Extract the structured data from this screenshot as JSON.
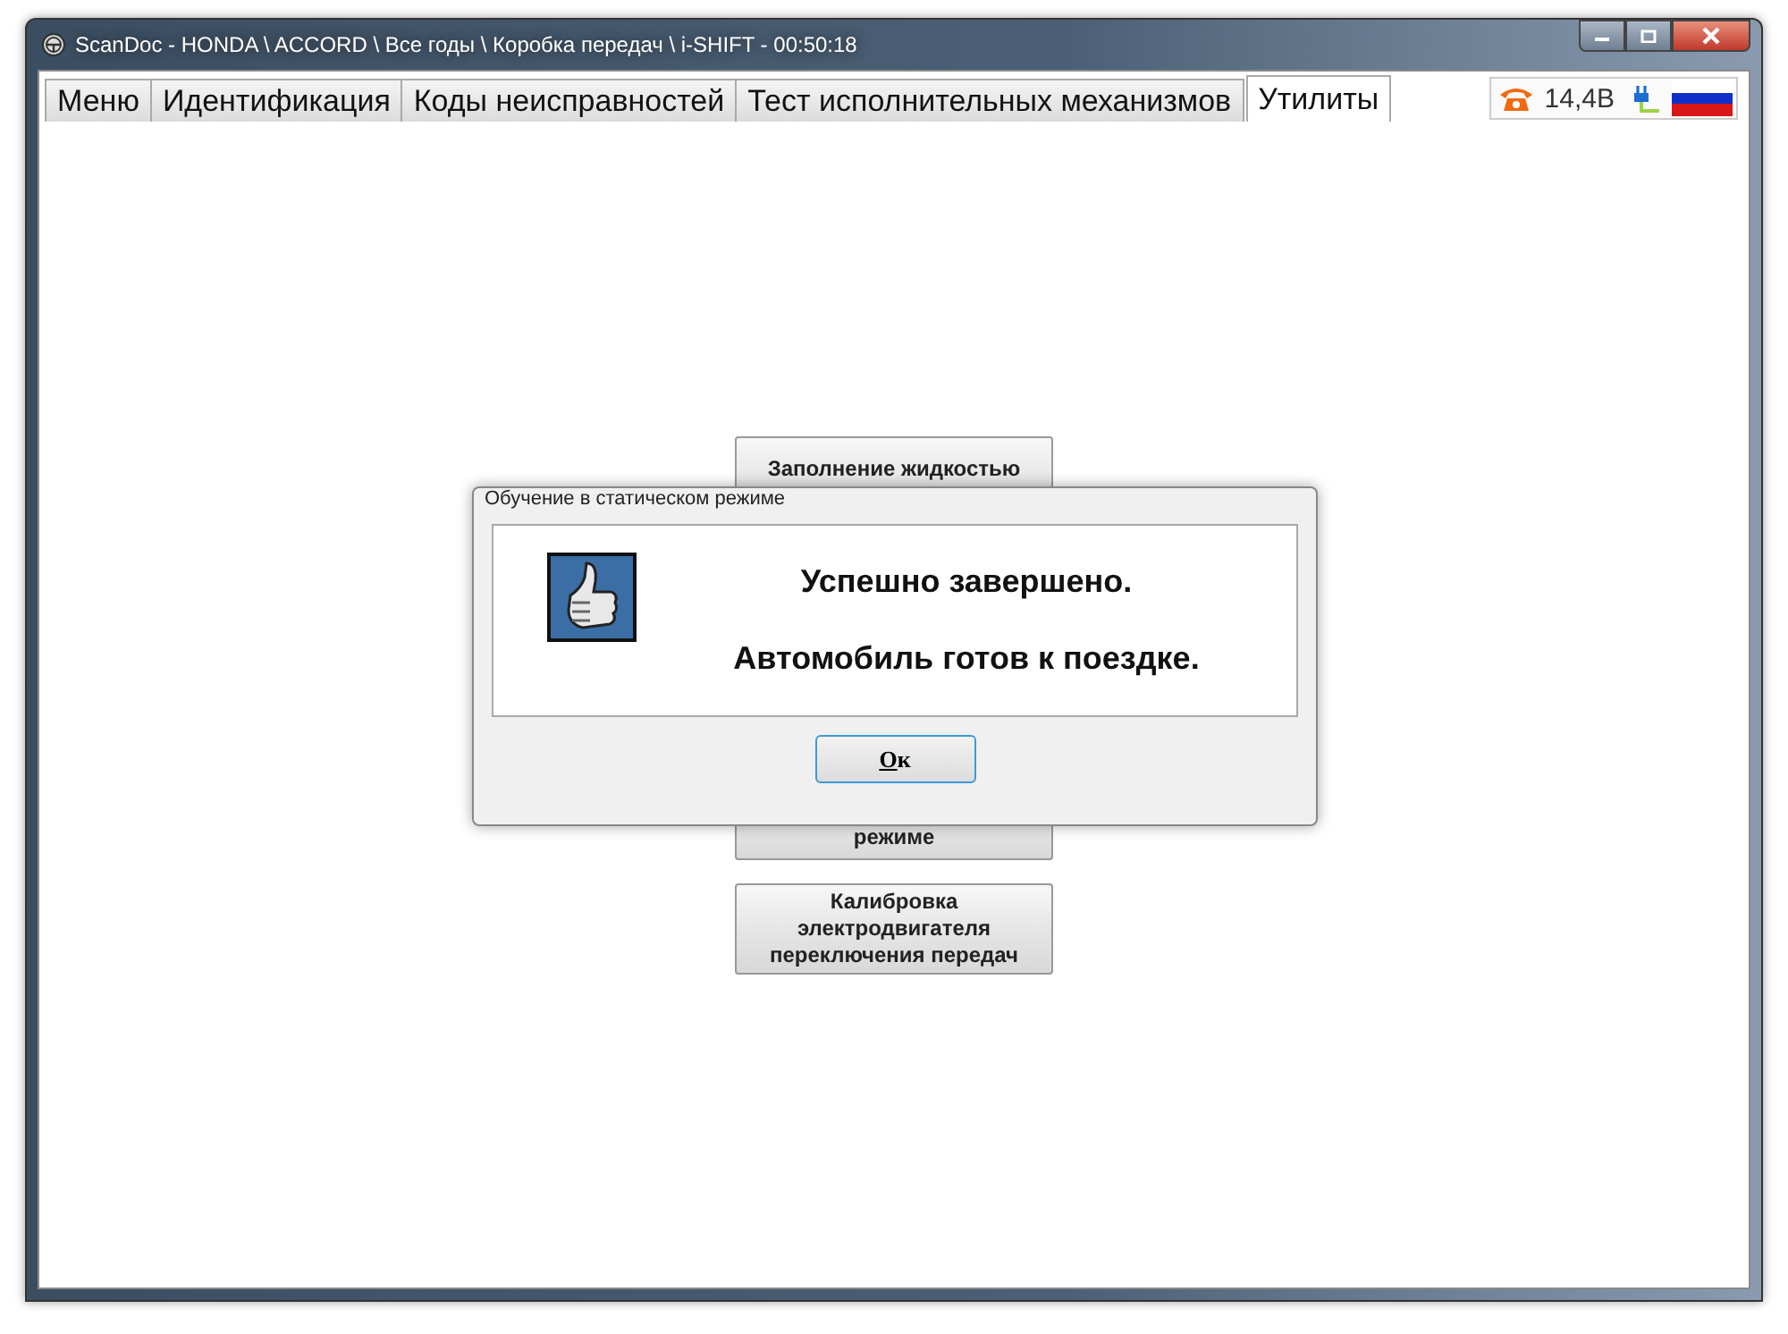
{
  "window": {
    "title": "ScanDoc - HONDA \\ ACCORD \\ Все годы \\ Коробка передач \\ i-SHIFT - 00:50:18"
  },
  "tabs": [
    {
      "label": "Меню",
      "selected": false
    },
    {
      "label": "Идентификация",
      "selected": false
    },
    {
      "label": "Коды неисправностей",
      "selected": false
    },
    {
      "label": "Тест исполнительных механизмов",
      "selected": false
    },
    {
      "label": "Утилиты",
      "selected": true
    }
  ],
  "status": {
    "voltage": "14,4В"
  },
  "function_buttons": [
    {
      "lines": [
        "Заполнение жидкостью"
      ]
    },
    {
      "lines": [
        "режиме"
      ]
    },
    {
      "lines": [
        "Калибровка",
        "электродвигателя",
        "переключения передач"
      ]
    }
  ],
  "dialog": {
    "title": "Обучение в статическом режиме",
    "messages": [
      "Успешно завершено.",
      "Автомобиль готов к поездке."
    ],
    "button": "Ок"
  }
}
